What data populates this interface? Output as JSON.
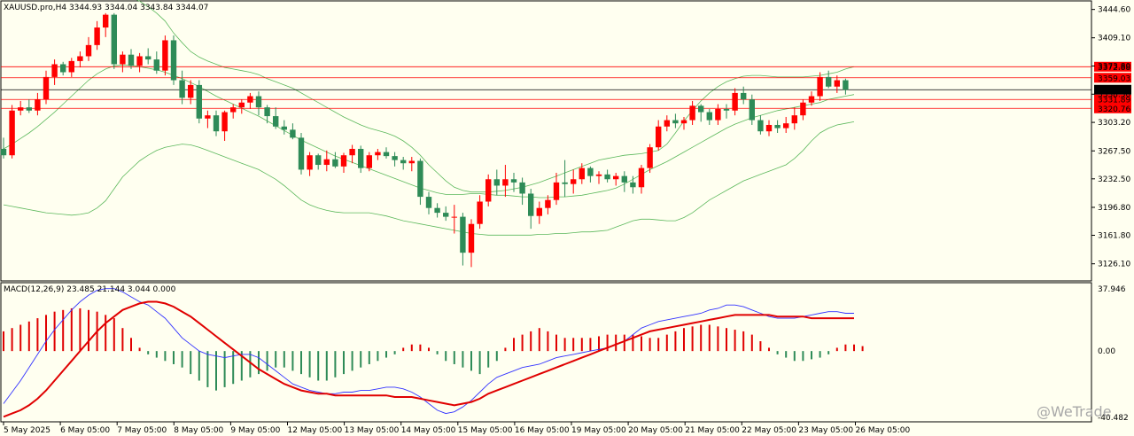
{
  "chart_data": {
    "type": "candlestick",
    "price_panel": {
      "header": "XAUUSD.pro,H4  3344.93 3344.04 3343.84 3344.07",
      "ylim": [
        3108,
        3452
      ],
      "y_ticks": [
        "3444.60",
        "3409.10",
        "3373.80",
        "3338.50",
        "3303.20",
        "3267.50",
        "3232.50",
        "3196.80",
        "3161.80",
        "3126.10"
      ],
      "price_lines": [
        {
          "label": "3372.88",
          "value": 3372.88,
          "color": "#ff0000"
        },
        {
          "label": "3359.03",
          "value": 3359.03,
          "color": "#ff0000"
        },
        {
          "label": "3344.07",
          "value": 3344.07,
          "color": "#000000"
        },
        {
          "label": "3331.89",
          "value": 3331.89,
          "color": "#ff0000"
        },
        {
          "label": "3320.76",
          "value": 3320.76,
          "color": "#ff0000"
        }
      ],
      "candles": [
        [
          3270,
          3284,
          3258,
          3262
        ],
        [
          3262,
          3325,
          3258,
          3318
        ],
        [
          3318,
          3330,
          3312,
          3322
        ],
        [
          3322,
          3332,
          3315,
          3318
        ],
        [
          3318,
          3340,
          3312,
          3332
        ],
        [
          3332,
          3368,
          3326,
          3360
        ],
        [
          3360,
          3382,
          3350,
          3376
        ],
        [
          3376,
          3379,
          3362,
          3366
        ],
        [
          3366,
          3384,
          3360,
          3380
        ],
        [
          3380,
          3392,
          3372,
          3386
        ],
        [
          3386,
          3410,
          3380,
          3400
        ],
        [
          3400,
          3430,
          3394,
          3422
        ],
        [
          3422,
          3440,
          3410,
          3438
        ],
        [
          3438,
          3440,
          3370,
          3376
        ],
        [
          3376,
          3392,
          3366,
          3388
        ],
        [
          3388,
          3395,
          3370,
          3374
        ],
        [
          3374,
          3390,
          3366,
          3386
        ],
        [
          3386,
          3396,
          3376,
          3382
        ],
        [
          3382,
          3392,
          3364,
          3368
        ],
        [
          3368,
          3412,
          3362,
          3406
        ],
        [
          3406,
          3412,
          3350,
          3356
        ],
        [
          3356,
          3368,
          3326,
          3334
        ],
        [
          3334,
          3356,
          3326,
          3350
        ],
        [
          3350,
          3356,
          3302,
          3308
        ],
        [
          3308,
          3318,
          3296,
          3312
        ],
        [
          3312,
          3318,
          3286,
          3292
        ],
        [
          3292,
          3318,
          3280,
          3316
        ],
        [
          3316,
          3326,
          3308,
          3322
        ],
        [
          3322,
          3332,
          3314,
          3328
        ],
        [
          3328,
          3340,
          3320,
          3336
        ],
        [
          3336,
          3342,
          3312,
          3322
        ],
        [
          3322,
          3325,
          3302,
          3311
        ],
        [
          3311,
          3322,
          3295,
          3298
        ],
        [
          3298,
          3306,
          3288,
          3294
        ],
        [
          3294,
          3302,
          3282,
          3284
        ],
        [
          3284,
          3290,
          3238,
          3244
        ],
        [
          3244,
          3266,
          3236,
          3262
        ],
        [
          3262,
          3264,
          3244,
          3250
        ],
        [
          3250,
          3268,
          3242,
          3257
        ],
        [
          3257,
          3266,
          3246,
          3248
        ],
        [
          3248,
          3265,
          3240,
          3262
        ],
        [
          3262,
          3275,
          3252,
          3270
        ],
        [
          3270,
          3274,
          3240,
          3246
        ],
        [
          3246,
          3266,
          3242,
          3262
        ],
        [
          3262,
          3270,
          3256,
          3266
        ],
        [
          3266,
          3272,
          3258,
          3261
        ],
        [
          3261,
          3266,
          3248,
          3256
        ],
        [
          3256,
          3260,
          3244,
          3252
        ],
        [
          3252,
          3260,
          3242,
          3255
        ],
        [
          3255,
          3258,
          3200,
          3210
        ],
        [
          3210,
          3216,
          3188,
          3196
        ],
        [
          3196,
          3202,
          3184,
          3190
        ],
        [
          3190,
          3198,
          3180,
          3185
        ],
        [
          3185,
          3200,
          3164,
          3185
        ],
        [
          3185,
          3190,
          3124,
          3140
        ],
        [
          3140,
          3182,
          3122,
          3176
        ],
        [
          3176,
          3212,
          3170,
          3204
        ],
        [
          3204,
          3238,
          3198,
          3232
        ],
        [
          3232,
          3244,
          3212,
          3224
        ],
        [
          3224,
          3250,
          3210,
          3232
        ],
        [
          3232,
          3240,
          3216,
          3228
        ],
        [
          3228,
          3234,
          3200,
          3214
        ],
        [
          3214,
          3220,
          3170,
          3186
        ],
        [
          3186,
          3204,
          3176,
          3196
        ],
        [
          3196,
          3212,
          3188,
          3206
        ],
        [
          3206,
          3240,
          3200,
          3228
        ],
        [
          3228,
          3256,
          3210,
          3226
        ],
        [
          3226,
          3244,
          3214,
          3232
        ],
        [
          3232,
          3252,
          3226,
          3246
        ],
        [
          3246,
          3248,
          3228,
          3236
        ],
        [
          3236,
          3242,
          3226,
          3238
        ],
        [
          3238,
          3244,
          3228,
          3232
        ],
        [
          3232,
          3240,
          3224,
          3236
        ],
        [
          3236,
          3242,
          3216,
          3228
        ],
        [
          3228,
          3236,
          3214,
          3222
        ],
        [
          3222,
          3250,
          3214,
          3246
        ],
        [
          3246,
          3276,
          3240,
          3272
        ],
        [
          3272,
          3306,
          3268,
          3298
        ],
        [
          3298,
          3312,
          3292,
          3306
        ],
        [
          3306,
          3314,
          3296,
          3302
        ],
        [
          3302,
          3310,
          3294,
          3306
        ],
        [
          3306,
          3330,
          3300,
          3324
        ],
        [
          3324,
          3326,
          3304,
          3316
        ],
        [
          3316,
          3320,
          3300,
          3306
        ],
        [
          3306,
          3326,
          3300,
          3320
        ],
        [
          3320,
          3326,
          3308,
          3318
        ],
        [
          3318,
          3346,
          3312,
          3340
        ],
        [
          3340,
          3348,
          3326,
          3332
        ],
        [
          3332,
          3338,
          3300,
          3306
        ],
        [
          3306,
          3312,
          3288,
          3292
        ],
        [
          3292,
          3306,
          3286,
          3300
        ],
        [
          3300,
          3306,
          3290,
          3296
        ],
        [
          3296,
          3310,
          3290,
          3302
        ],
        [
          3302,
          3322,
          3294,
          3312
        ],
        [
          3312,
          3332,
          3306,
          3328
        ],
        [
          3328,
          3342,
          3324,
          3336
        ],
        [
          3336,
          3366,
          3330,
          3360
        ],
        [
          3360,
          3368,
          3346,
          3348
        ],
        [
          3348,
          3362,
          3340,
          3356
        ],
        [
          3356,
          3358,
          3338,
          3344
        ]
      ],
      "bb_upper": [
        3460,
        3465,
        3468,
        3470,
        3472,
        3474,
        3476,
        3478,
        3480,
        3481,
        3480,
        3478,
        3475,
        3470,
        3465,
        3460,
        3455,
        3448,
        3440,
        3430,
        3415,
        3403,
        3392,
        3385,
        3380,
        3376,
        3372,
        3370,
        3368,
        3366,
        3363,
        3358,
        3354,
        3350,
        3346,
        3340,
        3334,
        3328,
        3322,
        3316,
        3310,
        3305,
        3300,
        3296,
        3293,
        3290,
        3286,
        3280,
        3272,
        3262,
        3250,
        3240,
        3230,
        3222,
        3218,
        3216,
        3216,
        3216,
        3217,
        3218,
        3220,
        3222,
        3225,
        3228,
        3232,
        3236,
        3240,
        3244,
        3248,
        3252,
        3256,
        3258,
        3260,
        3262,
        3263,
        3264,
        3266,
        3268,
        3276,
        3290,
        3305,
        3318,
        3330,
        3340,
        3348,
        3354,
        3358,
        3361,
        3362,
        3362,
        3361,
        3360,
        3360,
        3360,
        3360,
        3361,
        3362,
        3364,
        3366,
        3370,
        3373
      ],
      "bb_middle": [
        3270,
        3276,
        3283,
        3290,
        3298,
        3307,
        3316,
        3326,
        3336,
        3346,
        3356,
        3364,
        3370,
        3374,
        3375,
        3375,
        3373,
        3371,
        3369,
        3366,
        3362,
        3358,
        3353,
        3348,
        3342,
        3336,
        3331,
        3326,
        3321,
        3316,
        3311,
        3305,
        3299,
        3293,
        3287,
        3281,
        3276,
        3271,
        3266,
        3261,
        3257,
        3253,
        3249,
        3245,
        3241,
        3237,
        3233,
        3229,
        3225,
        3221,
        3218,
        3215,
        3213,
        3213,
        3213,
        3214,
        3214,
        3213,
        3212,
        3212,
        3211,
        3210,
        3210,
        3209,
        3209,
        3210,
        3210,
        3211,
        3212,
        3214,
        3216,
        3218,
        3221,
        3226,
        3232,
        3238,
        3244,
        3249,
        3254,
        3260,
        3266,
        3272,
        3278,
        3284,
        3290,
        3296,
        3301,
        3305,
        3309,
        3312,
        3315,
        3318,
        3320,
        3322,
        3324,
        3326,
        3328,
        3332,
        3334,
        3336,
        3338
      ],
      "bb_lower": [
        3200,
        3198,
        3196,
        3194,
        3192,
        3190,
        3189,
        3188,
        3187,
        3188,
        3190,
        3196,
        3205,
        3220,
        3235,
        3245,
        3255,
        3262,
        3268,
        3272,
        3274,
        3276,
        3275,
        3272,
        3268,
        3264,
        3260,
        3256,
        3252,
        3248,
        3244,
        3238,
        3232,
        3224,
        3215,
        3206,
        3200,
        3196,
        3193,
        3191,
        3190,
        3190,
        3190,
        3190,
        3188,
        3186,
        3183,
        3180,
        3178,
        3176,
        3174,
        3172,
        3170,
        3168,
        3166,
        3164,
        3163,
        3162,
        3162,
        3162,
        3162,
        3162,
        3162,
        3163,
        3163,
        3164,
        3164,
        3165,
        3166,
        3166,
        3167,
        3168,
        3172,
        3176,
        3180,
        3182,
        3182,
        3181,
        3180,
        3180,
        3184,
        3190,
        3198,
        3206,
        3212,
        3218,
        3224,
        3230,
        3234,
        3238,
        3242,
        3246,
        3250,
        3258,
        3268,
        3280,
        3290,
        3296,
        3300,
        3302,
        3304
      ]
    },
    "macd_panel": {
      "header": "MACD(12,26,9) 23.485 21.144 3.044 0.000",
      "ylim": [
        -42,
        40
      ],
      "y_ticks": [
        "37.946",
        "0.00",
        "-40.482"
      ],
      "hist": [
        12,
        14,
        16,
        18,
        20,
        22,
        24,
        25,
        26,
        26,
        25,
        24,
        22,
        20,
        14,
        8,
        2,
        -2,
        -4,
        -6,
        -8,
        -10,
        -14,
        -18,
        -22,
        -24,
        -22,
        -20,
        -18,
        -16,
        -14,
        -12,
        -10,
        -10,
        -12,
        -14,
        -16,
        -18,
        -18,
        -16,
        -14,
        -12,
        -10,
        -8,
        -6,
        -4,
        -2,
        2,
        4,
        4,
        2,
        -2,
        -6,
        -8,
        -10,
        -12,
        -14,
        -10,
        -6,
        2,
        8,
        10,
        12,
        14,
        12,
        10,
        8,
        8,
        8,
        8,
        9,
        10,
        10,
        10,
        10,
        9,
        8,
        8,
        10,
        12,
        14,
        15,
        16,
        16,
        15,
        14,
        13,
        12,
        10,
        6,
        2,
        -2,
        -4,
        -6,
        -6,
        -5,
        -4,
        -2,
        2,
        4,
        4,
        3
      ],
      "macd": [
        -32,
        -25,
        -18,
        -10,
        -2,
        6,
        13,
        19,
        25,
        30,
        34,
        37,
        38,
        38,
        36,
        33,
        30,
        28,
        24,
        20,
        14,
        8,
        4,
        0,
        -2,
        -3,
        -4,
        -3,
        -2,
        -2,
        -4,
        -8,
        -12,
        -16,
        -20,
        -22,
        -24,
        -25,
        -26,
        -26,
        -25,
        -25,
        -24,
        -24,
        -23,
        -22,
        -22,
        -23,
        -25,
        -28,
        -32,
        -36,
        -38,
        -37,
        -34,
        -30,
        -25,
        -20,
        -16,
        -14,
        -12,
        -10,
        -9,
        -8,
        -6,
        -4,
        -3,
        -2,
        -1,
        0,
        1,
        2,
        4,
        6,
        10,
        14,
        16,
        18,
        19,
        20,
        21,
        22,
        23,
        25,
        26,
        28,
        28,
        27,
        25,
        23,
        21,
        20,
        20,
        20,
        21,
        22,
        23,
        24,
        24,
        23,
        23
      ],
      "signal": [
        -40,
        -38,
        -36,
        -33,
        -29,
        -24,
        -18,
        -12,
        -6,
        0,
        6,
        12,
        17,
        21,
        25,
        27,
        29,
        30,
        30,
        29,
        27,
        24,
        21,
        17,
        13,
        9,
        5,
        1,
        -3,
        -7,
        -11,
        -14,
        -17,
        -20,
        -22,
        -24,
        -25,
        -26,
        -26,
        -27,
        -27,
        -27,
        -27,
        -27,
        -27,
        -27,
        -28,
        -28,
        -28,
        -29,
        -30,
        -31,
        -32,
        -33,
        -32,
        -31,
        -29,
        -26,
        -24,
        -22,
        -20,
        -18,
        -16,
        -14,
        -12,
        -10,
        -8,
        -6,
        -4,
        -2,
        0,
        2,
        4,
        6,
        8,
        10,
        12,
        13,
        14,
        15,
        16,
        17,
        18,
        19,
        20,
        21,
        22,
        22,
        22,
        22,
        22,
        21,
        21,
        21,
        21,
        20,
        20,
        20,
        20,
        20,
        20
      ]
    },
    "x_labels": [
      "5 May 2025",
      "6 May 05:00",
      "7 May 05:00",
      "8 May 05:00",
      "9 May 05:00",
      "12 May 05:00",
      "13 May 05:00",
      "14 May 05:00",
      "15 May 05:00",
      "16 May 05:00",
      "19 May 05:00",
      "20 May 05:00",
      "21 May 05:00",
      "22 May 05:00",
      "23 May 05:00",
      "26 May 05:00"
    ],
    "colors": {
      "bull": "#ff0000",
      "bear": "#2e8b57",
      "bb": "#5cb85c",
      "macd": "#3333ff",
      "signal": "#e00000",
      "hist_up": "#e00000",
      "hist_down": "#2e8b57"
    },
    "watermark": "@WeTrade"
  }
}
